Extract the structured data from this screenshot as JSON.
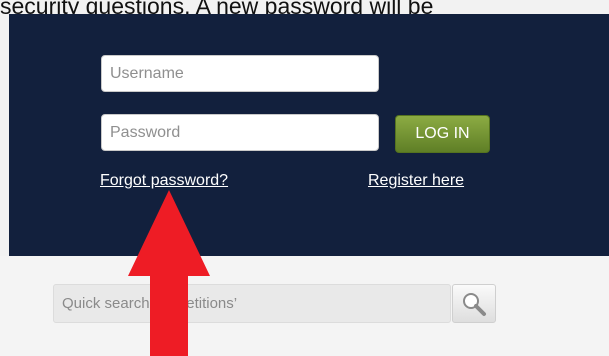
{
  "instruction": {
    "text": "security questions. A new password will be"
  },
  "login": {
    "username_placeholder": "Username",
    "password_placeholder": "Password",
    "login_label": "LOG IN",
    "forgot_label": "Forgot password?",
    "register_label": "Register here"
  },
  "search": {
    "placeholder": "Quick search on ‘petitions’",
    "button_icon": "magnifier-icon"
  },
  "annotation": {
    "arrow_icon": "red-up-arrow-icon",
    "arrow_color": "#ee1c25"
  },
  "colors": {
    "panel_bg": "#12203d",
    "login_button": "#6f8e2f",
    "link_color": "#ffffff"
  }
}
